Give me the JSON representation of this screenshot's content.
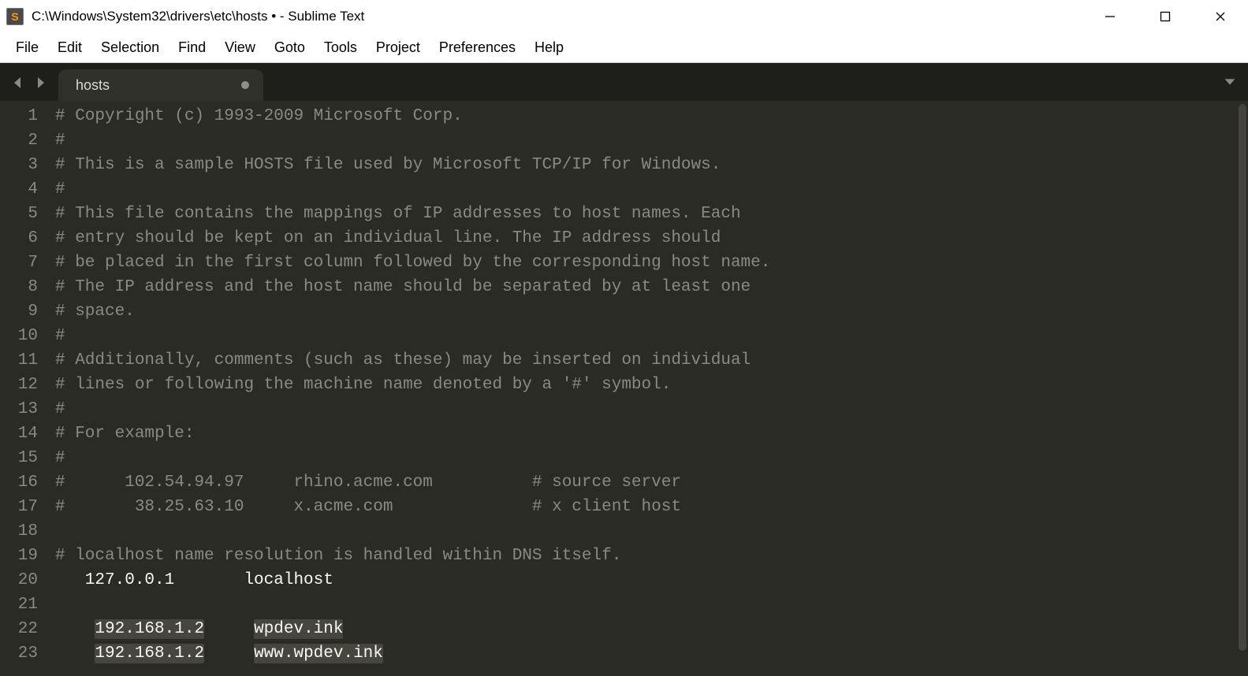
{
  "window": {
    "title": "C:\\Windows\\System32\\drivers\\etc\\hosts • - Sublime Text"
  },
  "menu": {
    "items": [
      "File",
      "Edit",
      "Selection",
      "Find",
      "View",
      "Goto",
      "Tools",
      "Project",
      "Preferences",
      "Help"
    ]
  },
  "tabs": {
    "active": {
      "label": "hosts",
      "dirty": true
    }
  },
  "editor": {
    "lines": [
      {
        "n": 1,
        "type": "comment",
        "text": "# Copyright (c) 1993-2009 Microsoft Corp."
      },
      {
        "n": 2,
        "type": "comment",
        "text": "#"
      },
      {
        "n": 3,
        "type": "comment",
        "text": "# This is a sample HOSTS file used by Microsoft TCP/IP for Windows."
      },
      {
        "n": 4,
        "type": "comment",
        "text": "#"
      },
      {
        "n": 5,
        "type": "comment",
        "text": "# This file contains the mappings of IP addresses to host names. Each"
      },
      {
        "n": 6,
        "type": "comment",
        "text": "# entry should be kept on an individual line. The IP address should"
      },
      {
        "n": 7,
        "type": "comment",
        "text": "# be placed in the first column followed by the corresponding host name."
      },
      {
        "n": 8,
        "type": "comment",
        "text": "# The IP address and the host name should be separated by at least one"
      },
      {
        "n": 9,
        "type": "comment",
        "text": "# space."
      },
      {
        "n": 10,
        "type": "comment",
        "text": "#"
      },
      {
        "n": 11,
        "type": "comment",
        "text": "# Additionally, comments (such as these) may be inserted on individual"
      },
      {
        "n": 12,
        "type": "comment",
        "text": "# lines or following the machine name denoted by a '#' symbol."
      },
      {
        "n": 13,
        "type": "comment",
        "text": "#"
      },
      {
        "n": 14,
        "type": "comment",
        "text": "# For example:"
      },
      {
        "n": 15,
        "type": "comment",
        "text": "#"
      },
      {
        "n": 16,
        "type": "comment",
        "text": "#      102.54.94.97     rhino.acme.com          # source server"
      },
      {
        "n": 17,
        "type": "comment",
        "text": "#       38.25.63.10     x.acme.com              # x client host"
      },
      {
        "n": 18,
        "type": "plain",
        "text": ""
      },
      {
        "n": 19,
        "type": "comment",
        "text": "# localhost name resolution is handled within DNS itself."
      },
      {
        "n": 20,
        "type": "plain",
        "text": "   127.0.0.1       localhost"
      },
      {
        "n": 21,
        "type": "plain",
        "text": ""
      },
      {
        "n": 22,
        "type": "entry",
        "pad": "    ",
        "ip": "192.168.1.2",
        "gap": "     ",
        "host": "wpdev.ink"
      },
      {
        "n": 23,
        "type": "entry",
        "pad": "    ",
        "ip": "192.168.1.2",
        "gap": "     ",
        "host": "www.wpdev.ink"
      }
    ]
  }
}
